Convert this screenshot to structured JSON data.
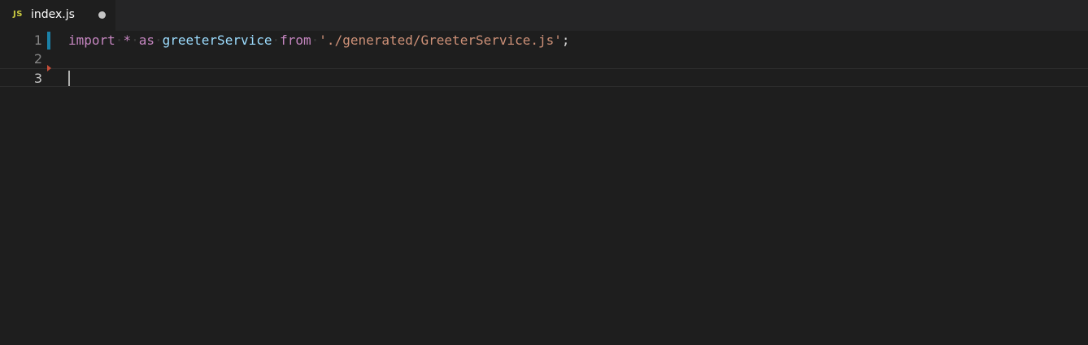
{
  "tab": {
    "icon": "JS",
    "label": "index.js",
    "dirty": true
  },
  "editor": {
    "lines": [
      {
        "number": "1",
        "tokens": {
          "import": "import",
          "star": "*",
          "as": "as",
          "name": "greeterService",
          "from": "from",
          "path": "'./generated/GreeterService.js'",
          "semi": ";"
        }
      },
      {
        "number": "2"
      },
      {
        "number": "3"
      }
    ]
  },
  "colors": {
    "keyword": "#c586c0",
    "variable": "#9cdcfe",
    "string": "#ce9178",
    "gutter_modified": "#1b81a8",
    "gutter_deleted": "#c74e39"
  }
}
